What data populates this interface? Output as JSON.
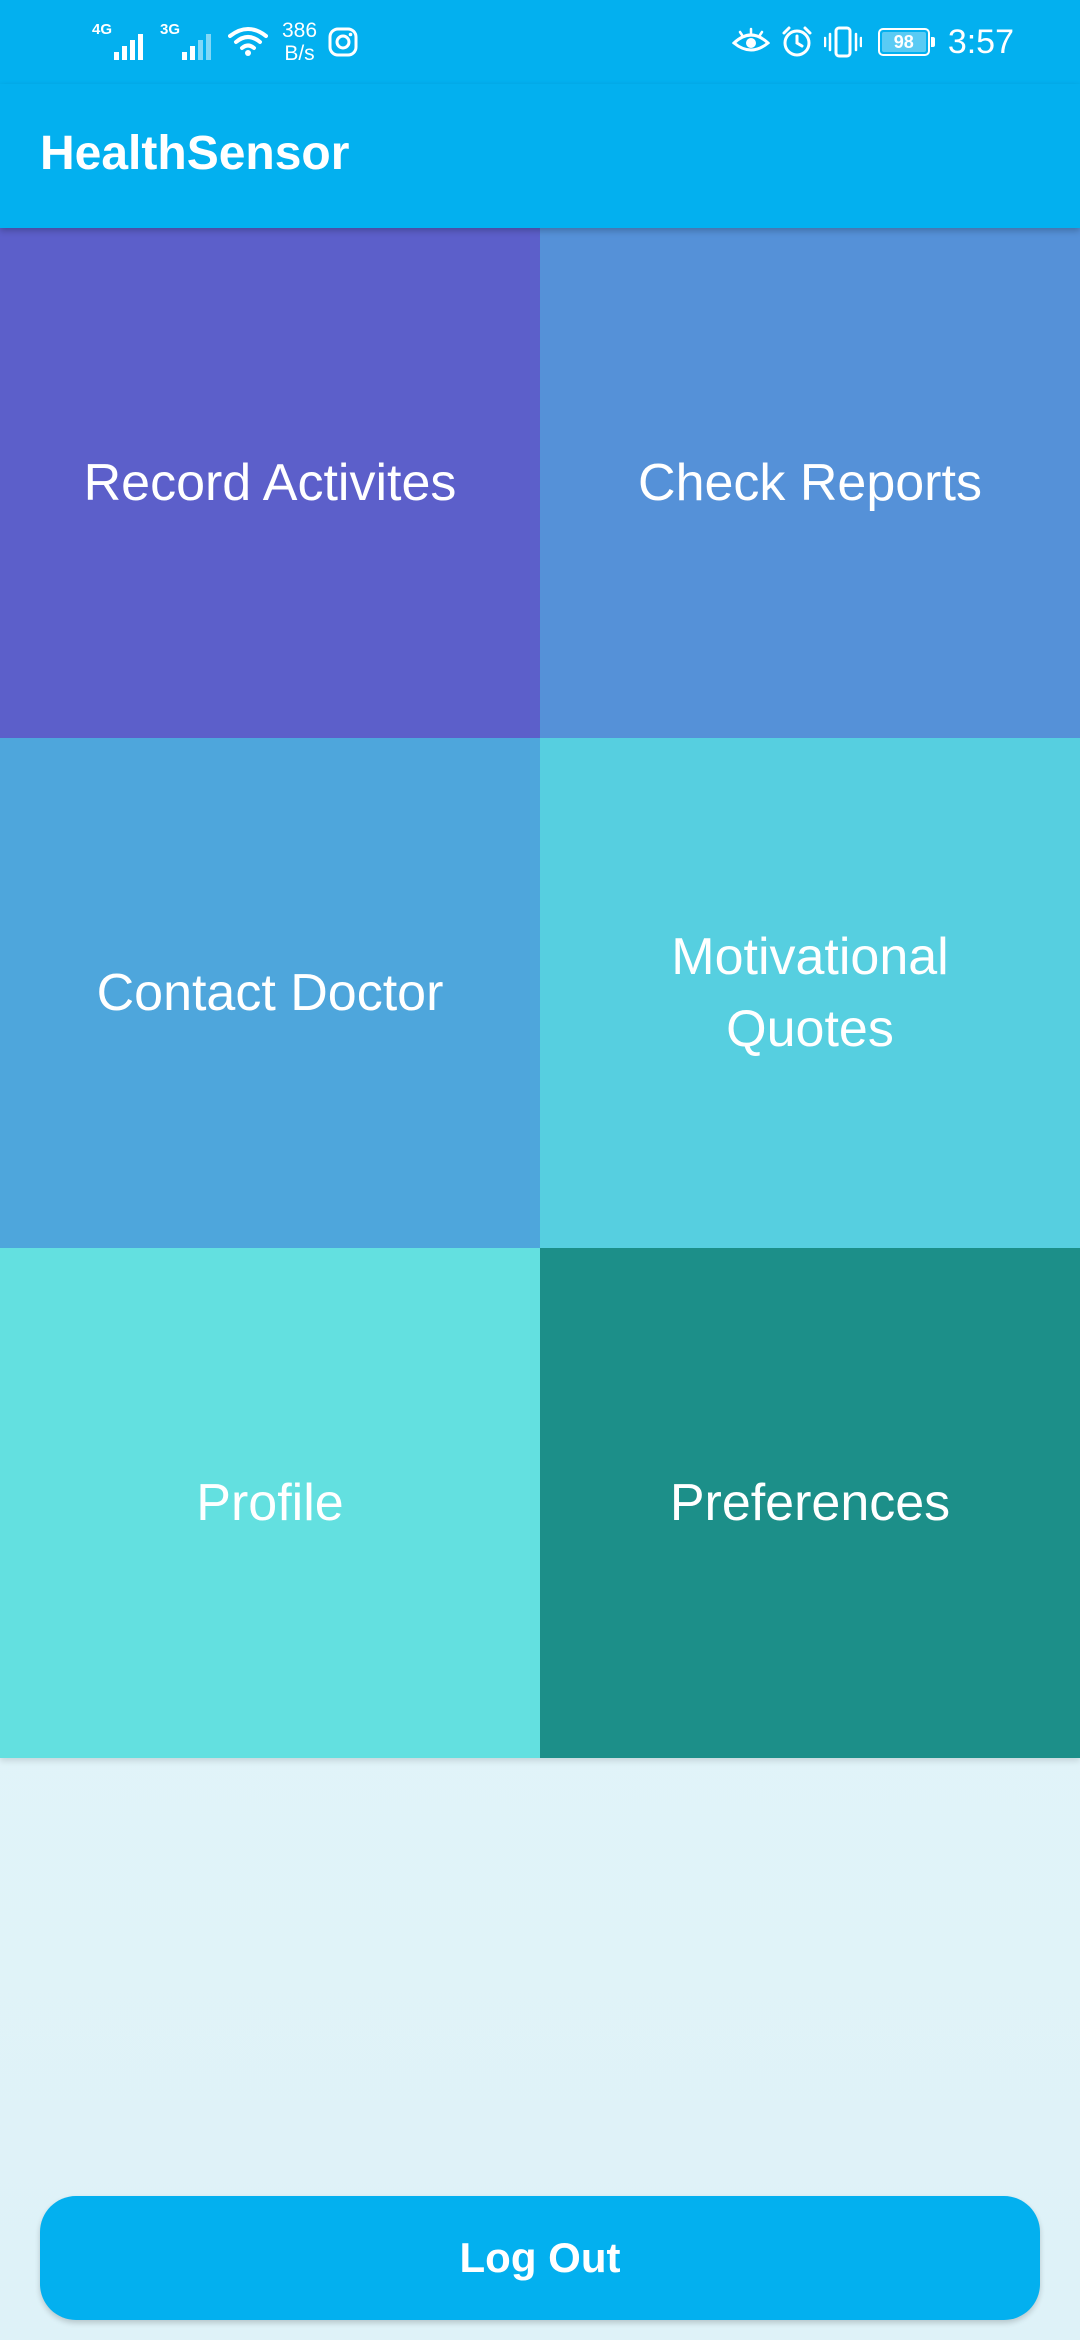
{
  "status_bar": {
    "network_1": "4G",
    "network_2": "3G",
    "data_speed_value": "386",
    "data_speed_unit": "B/s",
    "battery_level": "98",
    "time": "3:57",
    "icons": [
      "signal-icon",
      "signal-icon",
      "wifi-icon",
      "instagram-icon",
      "eye-comfort-icon",
      "alarm-icon",
      "vibrate-icon",
      "battery-icon"
    ]
  },
  "app_bar": {
    "title": "HealthSensor"
  },
  "menu": {
    "tiles": [
      {
        "label": "Record Activites",
        "color": "#5c5fca"
      },
      {
        "label": "Check Reports",
        "color": "#5591d8"
      },
      {
        "label": "Contact Doctor",
        "color": "#4ea6dc"
      },
      {
        "label": "Motivational Quotes",
        "color": "#56cfe0"
      },
      {
        "label": "Profile",
        "color": "#63e0e0"
      },
      {
        "label": "Preferences",
        "color": "#1c8f89"
      }
    ]
  },
  "footer": {
    "logout_label": "Log Out"
  },
  "colors": {
    "primary": "#03b0ef",
    "background": "#e4f5fa"
  }
}
